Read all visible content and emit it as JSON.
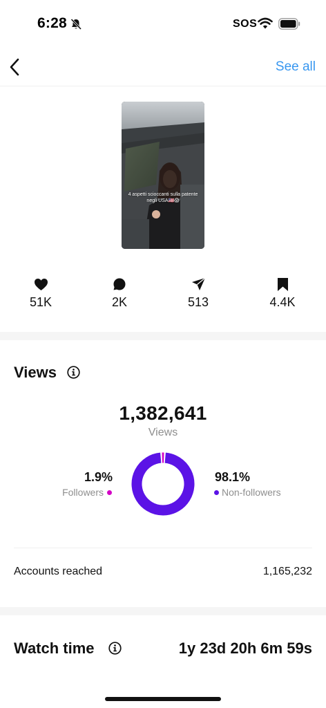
{
  "status_bar": {
    "time": "6:28",
    "sos": "SOS",
    "icons": [
      "bell-slash-icon",
      "wifi-icon",
      "battery-icon"
    ]
  },
  "header": {
    "back_icon": "chevron-left-icon",
    "see_all_label": "See all",
    "accent_color": "#3897f0"
  },
  "thumbnail": {
    "caption": "4 aspetti scioccanti sulla patente negli USA🇺🇸😱"
  },
  "engagement": [
    {
      "icon": "heart-icon",
      "value": "51K"
    },
    {
      "icon": "comment-icon",
      "value": "2K"
    },
    {
      "icon": "share-icon",
      "value": "513"
    },
    {
      "icon": "bookmark-icon",
      "value": "4.4K"
    }
  ],
  "views": {
    "title": "Views",
    "total": "1,382,641",
    "total_label": "Views",
    "followers_pct": "1.9%",
    "followers_label": "Followers",
    "non_followers_pct": "98.1%",
    "non_followers_label": "Non-followers",
    "followers_color": "#d300c5",
    "non_followers_color": "#5b13e6",
    "accounts_reached_label": "Accounts reached",
    "accounts_reached_value": "1,165,232"
  },
  "chart_data": {
    "type": "pie",
    "categories": [
      "Followers",
      "Non-followers"
    ],
    "values": [
      1.9,
      98.1
    ],
    "colors": [
      "#d300c5",
      "#5b13e6"
    ]
  },
  "watch_time": {
    "title": "Watch time",
    "value": "1y 23d 20h 6m 59s"
  }
}
